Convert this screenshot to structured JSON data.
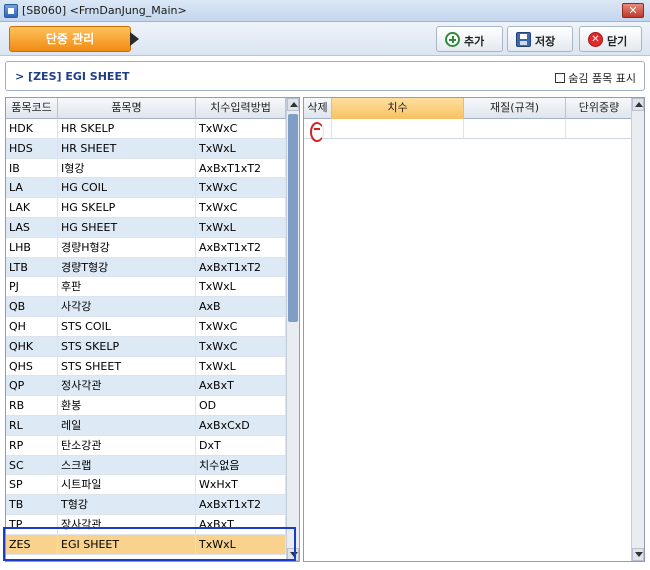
{
  "window": {
    "title": "[SB060]  <FrmDanJung_Main>",
    "close_label": "✕"
  },
  "toolbar": {
    "tab_label": "단중 관리",
    "add_label": "추가",
    "save_label": "저장",
    "close_label": "닫기"
  },
  "panel": {
    "title": "> [ZES] EGI SHEET",
    "checkbox_label": "숨김 품목 표시",
    "checkbox_checked": false
  },
  "left_grid": {
    "headers": [
      "품목코드",
      "품목명",
      "치수입력방법"
    ],
    "rows": [
      [
        "HDK",
        "HR SKELP",
        "TxWxC"
      ],
      [
        "HDS",
        "HR SHEET",
        "TxWxL"
      ],
      [
        "IB",
        "I형강",
        "AxBxT1xT2"
      ],
      [
        "LA",
        "HG COIL",
        "TxWxC"
      ],
      [
        "LAK",
        "HG SKELP",
        "TxWxC"
      ],
      [
        "LAS",
        "HG SHEET",
        "TxWxL"
      ],
      [
        "LHB",
        "경량H형강",
        "AxBxT1xT2"
      ],
      [
        "LTB",
        "경량T형강",
        "AxBxT1xT2"
      ],
      [
        "PJ",
        "후판",
        "TxWxL"
      ],
      [
        "QB",
        "사각강",
        "AxB"
      ],
      [
        "QH",
        "STS COIL",
        "TxWxC"
      ],
      [
        "QHK",
        "STS SKELP",
        "TxWxC"
      ],
      [
        "QHS",
        "STS SHEET",
        "TxWxL"
      ],
      [
        "QP",
        "정사각관",
        "AxBxT"
      ],
      [
        "RB",
        "환봉",
        "OD"
      ],
      [
        "RL",
        "레일",
        "AxBxCxD"
      ],
      [
        "RP",
        "탄소강관",
        "DxT"
      ],
      [
        "SC",
        "스크랩",
        "치수없음"
      ],
      [
        "SP",
        "시트파일",
        "WxHxT"
      ],
      [
        "TB",
        "T형강",
        "AxBxT1xT2"
      ],
      [
        "TP",
        "장사각관",
        "AxBxT"
      ],
      [
        "ZES",
        "EGI SHEET",
        "TxWxL"
      ]
    ],
    "selected_code": "ZES"
  },
  "right_grid": {
    "headers": [
      "삭제",
      "치수",
      "재질(규격)",
      "단위중량"
    ],
    "rows": [
      {
        "delete_icon": "minus-circle-icon",
        "size": "",
        "material": "",
        "unit_weight": ""
      }
    ]
  }
}
